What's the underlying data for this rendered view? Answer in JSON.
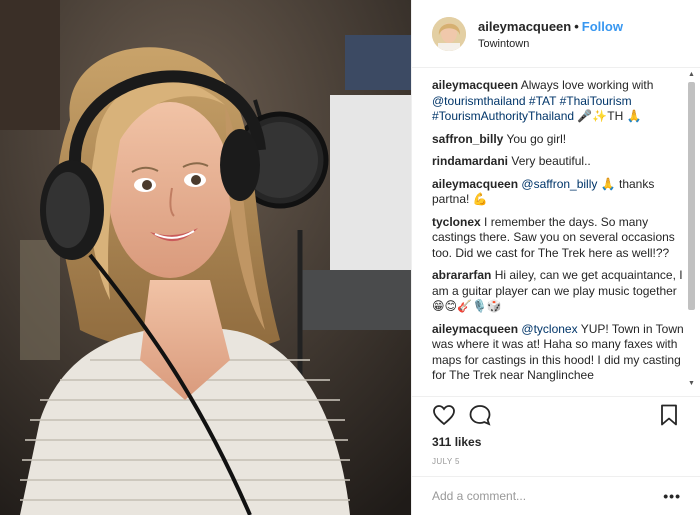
{
  "post": {
    "username": "aileymacqueen",
    "separator": "•",
    "follow_label": "Follow",
    "location": "Towintown",
    "likes": "311 likes",
    "date": "JULY 5",
    "comment_placeholder": "Add a comment...",
    "more_label": "•••"
  },
  "comments": [
    {
      "user": "aileymacqueen",
      "parts": [
        {
          "t": "Always love working with "
        },
        {
          "t": "@tourismthailand #TAT #ThaiTourism #TourismAuthorityThailand",
          "m": true
        },
        {
          "t": " 🎤✨TH 🙏"
        }
      ]
    },
    {
      "user": "saffron_billy",
      "parts": [
        {
          "t": "You go girl!"
        }
      ]
    },
    {
      "user": "rindamardani",
      "parts": [
        {
          "t": "Very beautiful.."
        }
      ]
    },
    {
      "user": "aileymacqueen",
      "parts": [
        {
          "t": "@saffron_billy",
          "m": true
        },
        {
          "t": " 🙏 thanks partna! 💪"
        }
      ]
    },
    {
      "user": "tyclonex",
      "parts": [
        {
          "t": "I remember the days. So many castings there. Saw you on several occasions too. Did we cast for The Trek here as well!??"
        }
      ]
    },
    {
      "user": "abrararfan",
      "parts": [
        {
          "t": "Hi ailey, can we get acquaintance, I am a guitar player can we play music together 😁😊🎸🎙️🎲"
        }
      ]
    },
    {
      "user": "aileymacqueen",
      "parts": [
        {
          "t": "@tyclonex",
          "m": true
        },
        {
          "t": " YUP! Town in Town was where it was at! Haha so many faxes with maps for castings in this hood! I did my casting for The Trek near Nanglinchee"
        }
      ]
    }
  ],
  "icons": {
    "like": "heart-icon",
    "comment": "speech-bubble-icon",
    "save": "bookmark-icon"
  },
  "colors": {
    "follow": "#3897f0",
    "mention": "#003569",
    "text": "#262626",
    "muted": "#999999"
  },
  "scrollbar": {
    "up": "▲",
    "down": "▼"
  }
}
